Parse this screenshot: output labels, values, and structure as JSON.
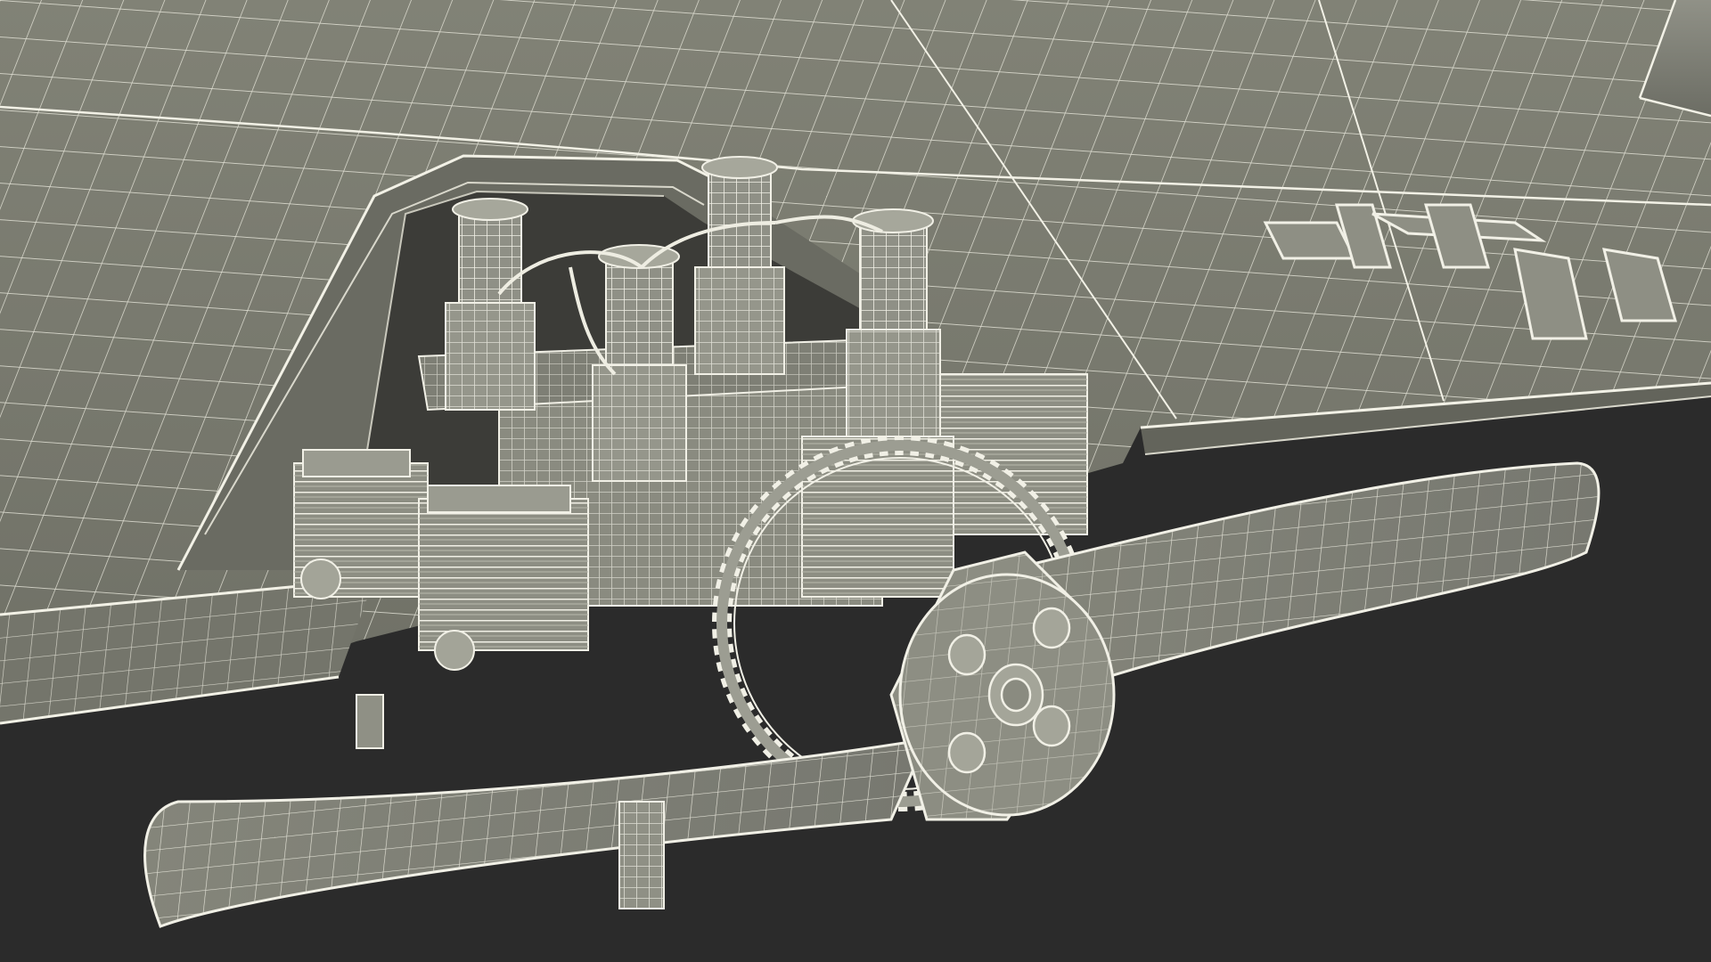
{
  "scene": {
    "subject": "wireframe-aircraft-engine",
    "colors": {
      "background": "#2b2b2b",
      "surface": "#7a7b70",
      "surface_dark": "#5f6057",
      "surface_light": "#8a8b80",
      "wire": "#e9e8dc",
      "cavity": "#3c3c38"
    }
  }
}
